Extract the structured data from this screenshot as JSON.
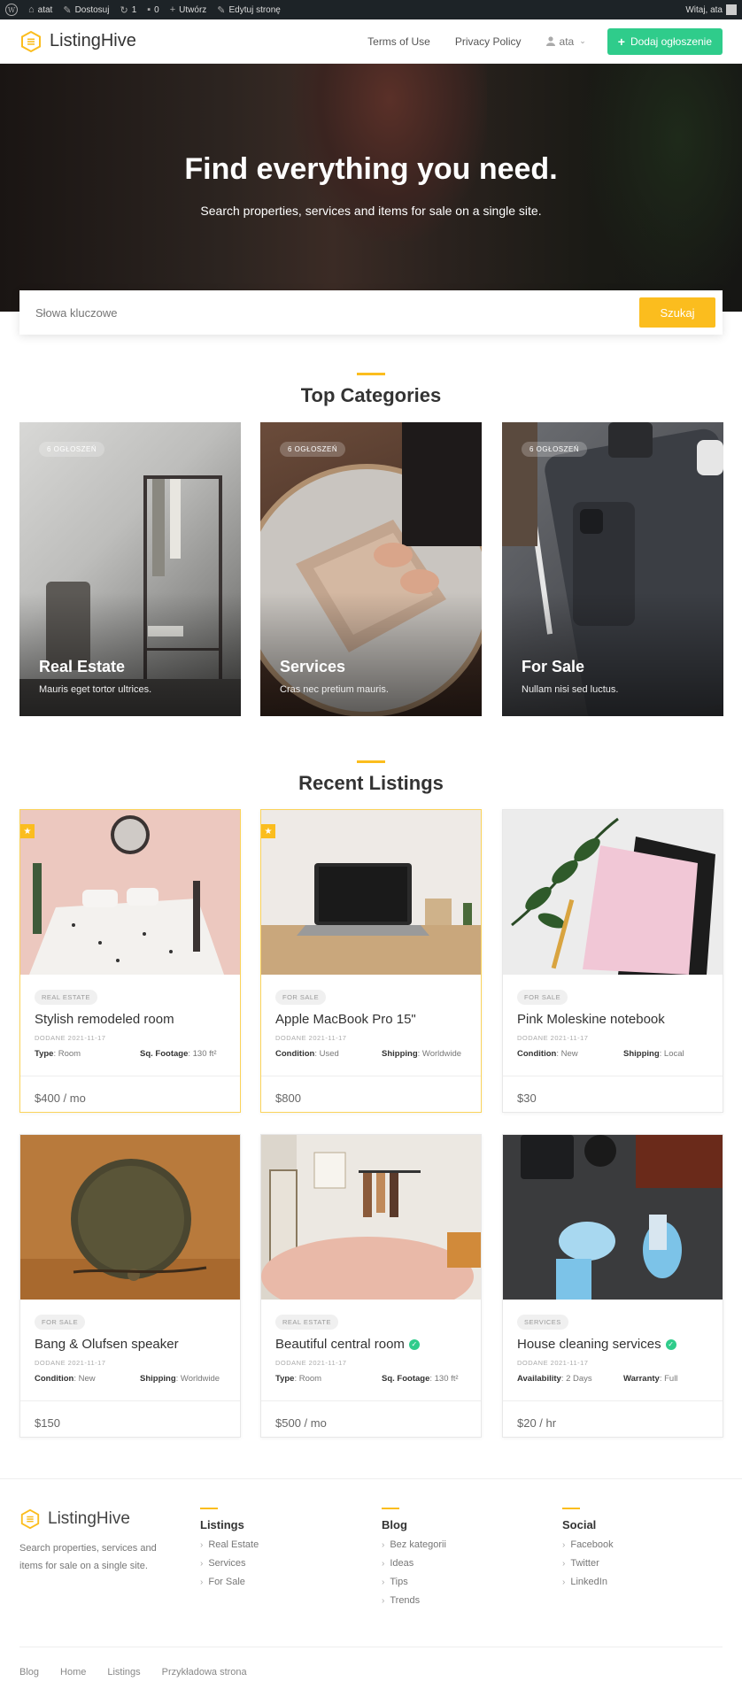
{
  "adminbar": {
    "site": "atat",
    "customize": "Dostosuj",
    "updates": "1",
    "comments": "0",
    "create": "Utwórz",
    "edit": "Edytuj stronę",
    "greeting": "Witaj, ata"
  },
  "header": {
    "logo": "ListingHive",
    "nav": [
      "Terms of Use",
      "Privacy Policy"
    ],
    "user": "ata",
    "add_button": "Dodaj ogłoszenie"
  },
  "hero": {
    "title": "Find everything you need.",
    "subtitle": "Search properties, services and items for sale on a single site."
  },
  "search": {
    "placeholder": "Słowa kluczowe",
    "button": "Szukaj"
  },
  "categories_section": {
    "title": "Top Categories",
    "items": [
      {
        "badge": "6 OGŁOSZEŃ",
        "name": "Real Estate",
        "desc": "Mauris eget tortor ultrices."
      },
      {
        "badge": "6 OGŁOSZEŃ",
        "name": "Services",
        "desc": "Cras nec pretium mauris."
      },
      {
        "badge": "6 OGŁOSZEŃ",
        "name": "For Sale",
        "desc": "Nullam nisi sed luctus."
      }
    ]
  },
  "listings_section": {
    "title": "Recent Listings",
    "items": [
      {
        "tag": "REAL ESTATE",
        "title": "Stylish remodeled room",
        "date": "DODANE 2021-11-17",
        "a1k": "Type",
        "a1v": ": Room",
        "a2k": "Sq. Footage",
        "a2v": ": 130 ft²",
        "price": "$400 / mo"
      },
      {
        "tag": "FOR SALE",
        "title": "Apple MacBook Pro 15\"",
        "date": "DODANE 2021-11-17",
        "a1k": "Condition",
        "a1v": ": Used",
        "a2k": "Shipping",
        "a2v": ": Worldwide",
        "price": "$800"
      },
      {
        "tag": "FOR SALE",
        "title": "Pink Moleskine notebook",
        "date": "DODANE 2021-11-17",
        "a1k": "Condition",
        "a1v": ": New",
        "a2k": "Shipping",
        "a2v": ": Local",
        "price": "$30"
      },
      {
        "tag": "FOR SALE",
        "title": "Bang & Olufsen speaker",
        "date": "DODANE 2021-11-17",
        "a1k": "Condition",
        "a1v": ": New",
        "a2k": "Shipping",
        "a2v": ": Worldwide",
        "price": "$150"
      },
      {
        "tag": "REAL ESTATE",
        "title": "Beautiful central room",
        "date": "DODANE 2021-11-17",
        "a1k": "Type",
        "a1v": ": Room",
        "a2k": "Sq. Footage",
        "a2v": ": 130 ft²",
        "price": "$500 / mo"
      },
      {
        "tag": "SERVICES",
        "title": "House cleaning services",
        "date": "DODANE 2021-11-17",
        "a1k": "Availability",
        "a1v": ": 2 Days",
        "a2k": "Warranty",
        "a2v": ": Full",
        "price": "$20 / hr"
      }
    ]
  },
  "footer": {
    "logo": "ListingHive",
    "desc": "Search properties, services and items for sale on a single site.",
    "columns": [
      {
        "title": "Listings",
        "links": [
          "Real Estate",
          "Services",
          "For Sale"
        ]
      },
      {
        "title": "Blog",
        "links": [
          "Bez kategorii",
          "Ideas",
          "Tips",
          "Trends"
        ]
      },
      {
        "title": "Social",
        "links": [
          "Facebook",
          "Twitter",
          "LinkedIn"
        ]
      }
    ],
    "bottom_links": [
      "Blog",
      "Home",
      "Listings",
      "Przykładowa strona"
    ]
  },
  "colors": {
    "accent": "#fbbd1e",
    "green": "#2fcc8b",
    "adminbar": "#1d2327"
  }
}
